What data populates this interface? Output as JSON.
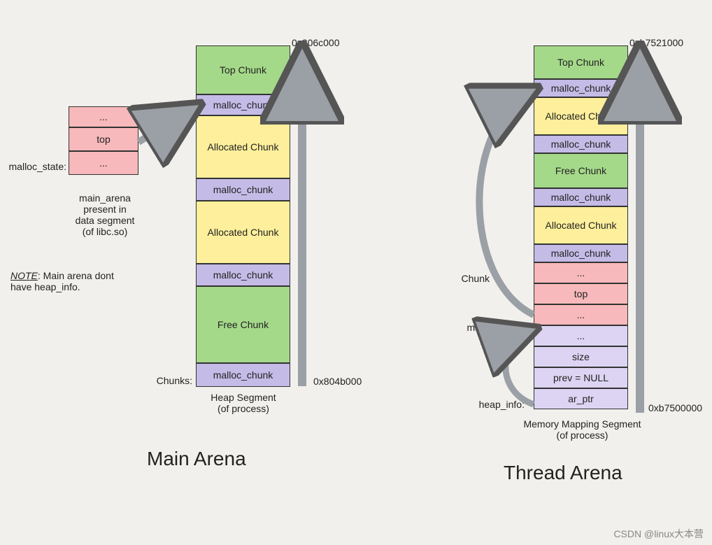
{
  "diagram": {
    "title_left": "Main Arena",
    "title_right": "Thread Arena",
    "watermark": "CSDN @linux大本营"
  },
  "labels": {
    "malloc_state": "malloc_state:",
    "main_arena_caption": "main_arena\npresent in\ndata segment\n(of libc.so)",
    "note_prefix": "NOTE",
    "note_text": ": Main arena dont\nhave heap_info.",
    "chunks": "Chunks:",
    "heap_segment": "Heap Segment\n(of process)",
    "memmap_segment": "Memory Mapping Segment\n(of process)",
    "chunk_label": "Chunk",
    "malloc_state_right": "malloc_state:",
    "heap_info": "heap_info:"
  },
  "addresses": {
    "main_top": "0x806c000",
    "main_bottom": "0x804b000",
    "thread_top": "0xb7521000",
    "thread_bottom": "0xb7500000"
  },
  "malloc_state_table": {
    "r0": "...",
    "r1": "top",
    "r2": "..."
  },
  "main_stack": {
    "c0": "Top Chunk",
    "c1": "malloc_chunk",
    "c2": "Allocated\nChunk",
    "c3": "malloc_chunk",
    "c4": "Allocated\nChunk",
    "c5": "malloc_chunk",
    "c6": "Free Chunk",
    "c7": "malloc_chunk"
  },
  "thread_stack": {
    "c0": "Top Chunk",
    "c1": "malloc_chunk",
    "c2": "Allocated\nChunk",
    "c3": "malloc_chunk",
    "c4": "Free Chunk",
    "c5": "malloc_chunk",
    "c6": "Allocated\nChunk",
    "c7": "malloc_chunk",
    "c8": "...",
    "c9": "top",
    "c10": "...",
    "c11": "...",
    "c12": "size",
    "c13": "prev = NULL",
    "c14": "ar_ptr"
  }
}
